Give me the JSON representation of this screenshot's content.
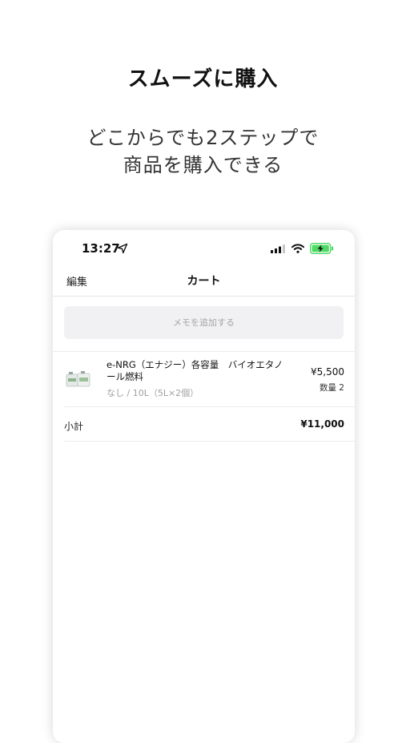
{
  "promo": {
    "headline": "スムーズに購入",
    "subline1": "どこからでも2ステップで",
    "subline2": "商品を購入できる"
  },
  "status_bar": {
    "time": "13:27",
    "icons": [
      "location-arrow-icon",
      "cellular-signal-icon",
      "wifi-icon",
      "battery-charging-icon"
    ],
    "battery_color": "#4cd964"
  },
  "nav": {
    "edit_label": "編集",
    "title": "カート"
  },
  "memo": {
    "button_label": "メモを追加する"
  },
  "cart": {
    "items": [
      {
        "name": "e-NRG（エナジー）各容量　バイオエタノール燃料",
        "variant": "なし / 10L（5L×2個）",
        "price": "¥5,500",
        "quantity": "数量 2"
      }
    ],
    "subtotal_label": "小計",
    "subtotal_value": "¥11,000"
  }
}
